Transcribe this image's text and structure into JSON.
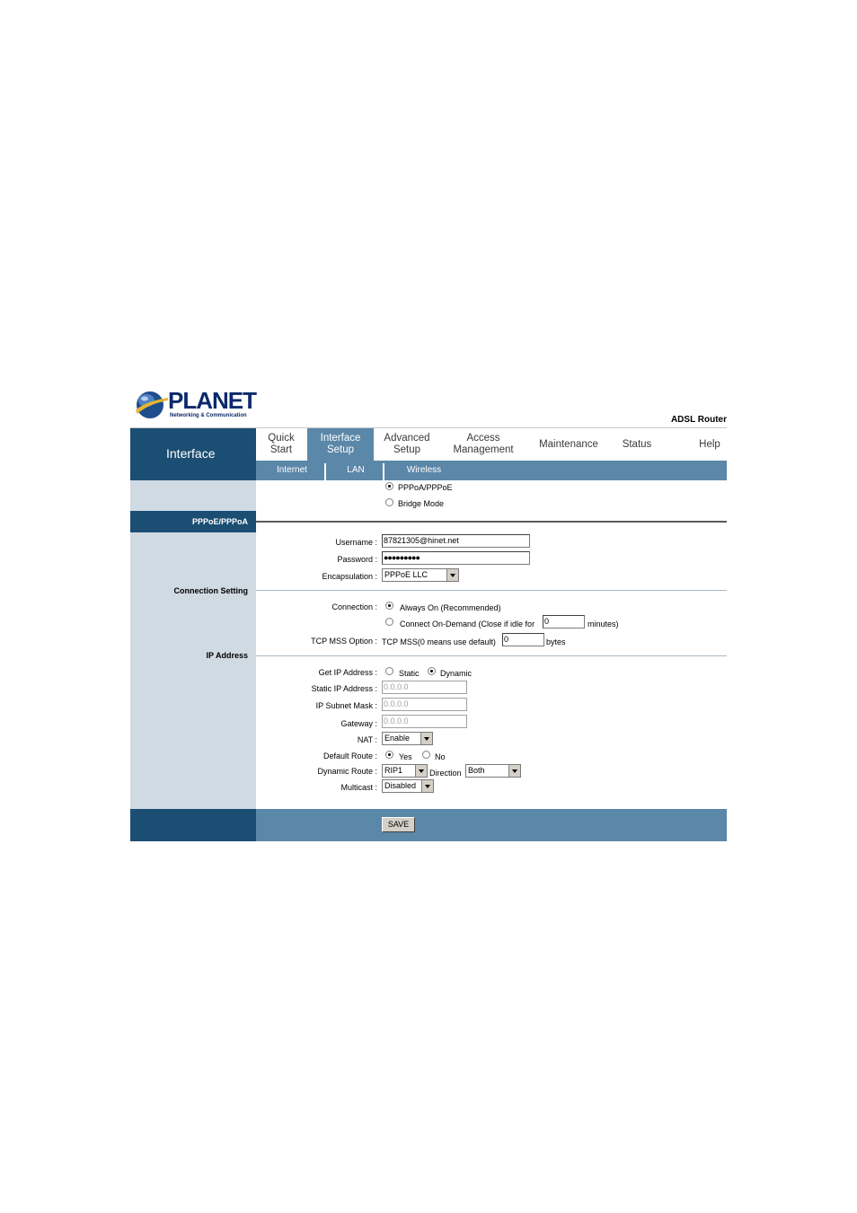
{
  "header": {
    "brand": "PLANET",
    "brand_tagline": "Networking & Communication",
    "product": "ADSL Router"
  },
  "left": {
    "title": "Interface",
    "section_pppoe": "PPPoE/PPPoA",
    "connection_setting": "Connection Setting",
    "ip_address": "IP Address"
  },
  "tabs": [
    {
      "line1": "Quick",
      "line2": "Start"
    },
    {
      "line1": "Interface",
      "line2": "Setup"
    },
    {
      "line1": "Advanced",
      "line2": "Setup"
    },
    {
      "line1": "Access",
      "line2": "Management"
    },
    {
      "line1": "Maintenance",
      "line2": ""
    },
    {
      "line1": "Status",
      "line2": ""
    },
    {
      "line1": "Help",
      "line2": ""
    }
  ],
  "subtabs": [
    "Internet",
    "LAN",
    "Wireless"
  ],
  "mode": {
    "option1": "PPPoA/PPPoE",
    "option2": "Bridge Mode",
    "selected": "PPPoA/PPPoE"
  },
  "account": {
    "username_label": "Username :",
    "username_value": "87821305@hinet.net",
    "password_label": "Password :",
    "password_value": "●●●●●●●●●",
    "encapsulation_label": "Encapsulation :",
    "encapsulation_value": "PPPoE LLC"
  },
  "connection": {
    "label": "Connection :",
    "always_on": "Always On (Recommended)",
    "on_demand": "Connect On-Demand (Close if idle for",
    "idle_value": "0",
    "minutes": "minutes)",
    "selected": "Always On (Recommended)",
    "tcp_label": "TCP MSS Option :",
    "tcp_text": "TCP MSS(0 means use default)",
    "tcp_value": "0",
    "bytes": "bytes"
  },
  "ip": {
    "get_label": "Get IP Address :",
    "static": "Static",
    "dynamic": "Dynamic",
    "selected": "Dynamic",
    "static_ip_label": "Static IP Address :",
    "static_ip_value": "0.0.0.0",
    "subnet_label": "IP Subnet Mask :",
    "subnet_value": "0.0.0.0",
    "gateway_label": "Gateway :",
    "gateway_value": "0.0.0.0",
    "nat_label": "NAT :",
    "nat_value": "Enable",
    "default_route_label": "Default Route :",
    "yes": "Yes",
    "no": "No",
    "default_route_selected": "Yes",
    "dynamic_route_label": "Dynamic Route :",
    "dynamic_route_value": "RIP1",
    "direction_label": "Direction",
    "direction_value": "Both",
    "multicast_label": "Multicast :",
    "multicast_value": "Disabled"
  },
  "footer": {
    "save_label": "SAVE"
  },
  "colors": {
    "navy": "#1c4e73",
    "steel": "#5b87a8",
    "panel": "#d0dae3"
  }
}
